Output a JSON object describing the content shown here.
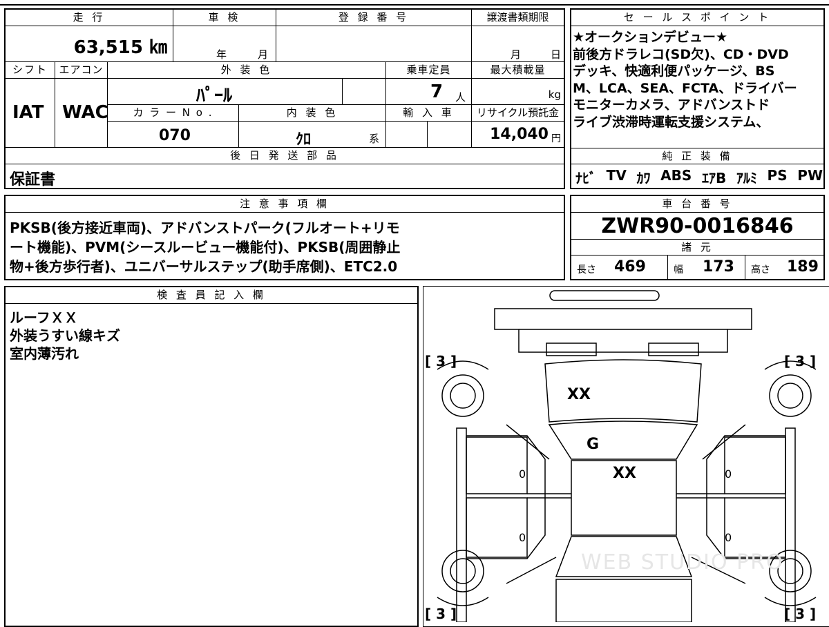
{
  "headers": {
    "mileage": "走 行",
    "shaken": "車 検",
    "registration": "登 録 番 号",
    "transfer_deadline": "譲渡書類期限",
    "shift": "シフト",
    "aircon": "エアコン",
    "exterior_color": "外 装 色",
    "capacity": "乗車定員",
    "max_load": "最大積載量",
    "color_no": "カ ラ ー N o .",
    "interior_color": "内 装 色",
    "import": "輸 入 車",
    "recycle": "リサイクル預託金",
    "later_parts": "後 日 発 送 部 品",
    "sales_point": "セ ー ル ス ポ イ ン ト",
    "genuine_equipment": "純 正 装 備",
    "notes": "注 意 事 項 欄",
    "chassis_no": "車 台 番 号",
    "specs": "諸 元",
    "inspector": "検 査 員 記 入 欄"
  },
  "vehicle": {
    "mileage_value": "63,515 ㎞",
    "shaken_year_unit": "年",
    "shaken_month_unit": "月",
    "transfer_month_unit": "月",
    "transfer_day_unit": "日",
    "shift": "IAT",
    "aircon": "WAC",
    "exterior_color": "ﾊﾟｰﾙ",
    "capacity_value": "7",
    "capacity_unit": "人",
    "max_load_unit": "kg",
    "color_no": "070",
    "interior_color": "ｸﾛ",
    "interior_color_suffix": "系",
    "recycle_value": "14,040",
    "recycle_unit": "円"
  },
  "later_parts_value": "保証書",
  "sales_point_text": "★オークションデビュー★\n前後方ドラレコ(SD欠)、CD・DVD\nデッキ、快適利便パッケージ、BS\nM、LCA、SEA、FCTA、ドライバー\nモニターカメラ、アドバンストド\nライブ渋滞時運転支援システム、",
  "genuine_equipment_items": [
    "ﾅﾋﾞ",
    "TV",
    "ｶﾜ",
    "ABS",
    "ｴｱB",
    "ｱﾙﾐ",
    "PS",
    "PW"
  ],
  "notes_lines": [
    "PKSB(後方接近車両)、アドバンストパーク(フルオート+リモ",
    "ート機能)、PVM(シースルービュー機能付)、PKSB(周囲静止",
    "物+後方歩行者)、ユニバーサルステップ(助手席側)、ETC2.0"
  ],
  "chassis_no_value": "ZWR90-0016846",
  "specs": {
    "length_label": "長さ",
    "length_value": "469",
    "width_label": "幅",
    "width_value": "173",
    "height_label": "高さ",
    "height_value": "189"
  },
  "inspector_lines": [
    "ルーフＸＸ",
    "外装うすい線キズ",
    "室内薄汚れ"
  ],
  "diagram": {
    "tire_fl": "[ 3 ]",
    "tire_fr": "[ 3 ]",
    "tire_rl": "[ 3 ]",
    "tire_rr": "[ 3 ]",
    "hood_mark": "XX",
    "windshield_mark": "G",
    "roof_mark": "XX",
    "door_fl": "0",
    "door_rl": "0",
    "door_fr": "0",
    "door_rr": "0",
    "watermark": "WEB STUDIO PRO"
  }
}
